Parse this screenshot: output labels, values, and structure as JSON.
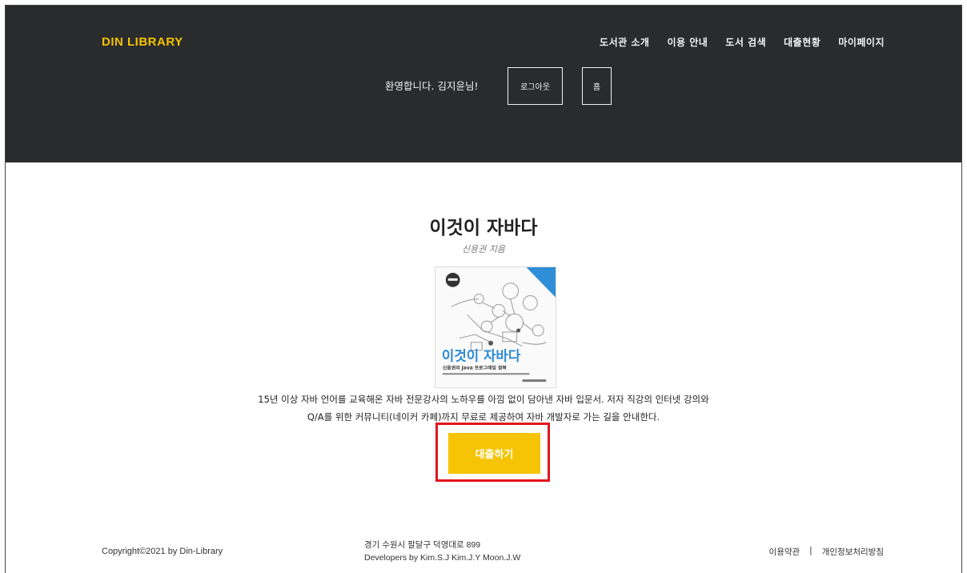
{
  "header": {
    "logo": "DIN LIBRARY",
    "nav": [
      "도서관 소개",
      "이용 안내",
      "도서 검색",
      "대출현황",
      "마이페이지"
    ],
    "welcome": "환영합니다. 김지윤님!",
    "logout_label": "로그아웃",
    "home_label": "홈"
  },
  "book": {
    "title": "이것이 자바다",
    "author": "신용권 지음",
    "description_line1": "15년 이상 자바 언어를 교육해온 자바 전문강사의 노하우를 아낌 없이 담아낸 자바 입문서. 저자 직강의 인터넷 강의와",
    "description_line2": "Q/A를 위한 커뮤니티(네이커 카페)까지 무료로 제공하여 자바 개발자로 가는 길을 안내한다.",
    "cover": {
      "title": "이것이 자바다",
      "subtitle": "신용권의 Java 프로그래밍 정복"
    },
    "loan_label": "대출하기"
  },
  "footer": {
    "copyright": "Copyright©2021 by Din-Library",
    "address": "경기 수원시 팔달구 덕영대로 899",
    "developers": "Developers by Kim.S.J Kim.J.Y Moon.J.W",
    "terms": "이용약관",
    "separator": "|",
    "privacy": "개인정보처리방침"
  },
  "colors": {
    "header_bg": "#2a2b2d",
    "accent": "#f6c404",
    "highlight": "#e2141b"
  }
}
